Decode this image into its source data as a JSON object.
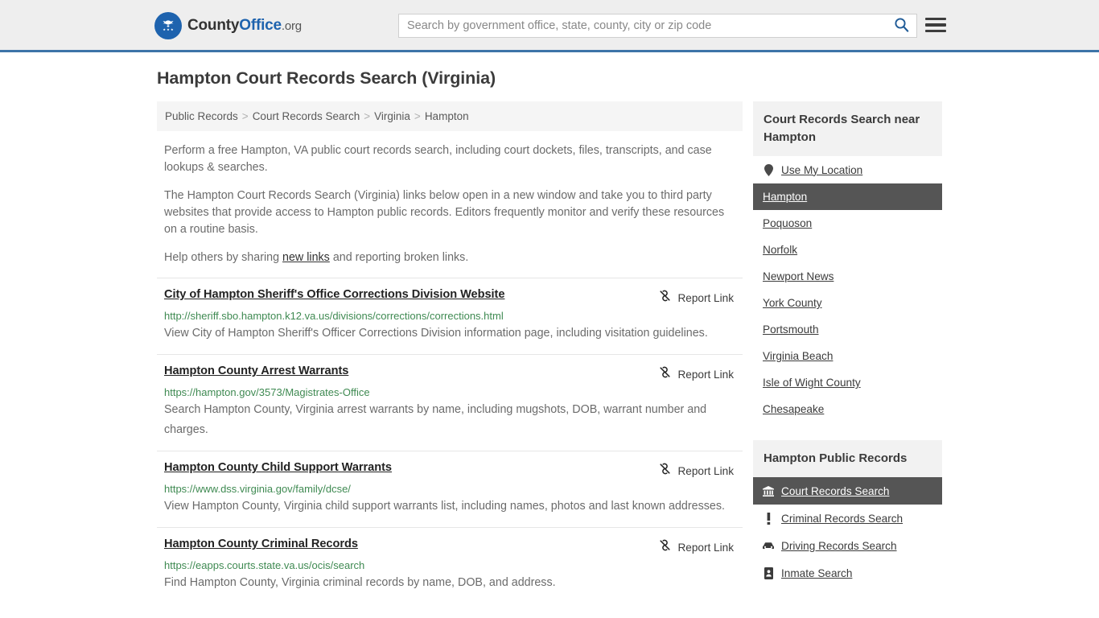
{
  "header": {
    "logo": {
      "part1": "County",
      "part2": "Office",
      "part3": ".org",
      "icon": "eagle-seal-icon"
    },
    "search": {
      "placeholder": "Search by government office, state, county, city or zip code",
      "value": "",
      "search_icon": "search-icon"
    },
    "menu_icon": "hamburger-menu-icon",
    "accent_color": "#1e63ae",
    "border_color": "#3d74a8",
    "background": "#eeeeee"
  },
  "page": {
    "title": "Hampton Court Records Search (Virginia)"
  },
  "breadcrumb": {
    "separator": ">",
    "items": [
      {
        "label": "Public Records"
      },
      {
        "label": "Court Records Search"
      },
      {
        "label": "Virginia"
      },
      {
        "label": "Hampton"
      }
    ]
  },
  "intro": {
    "p1": "Perform a free Hampton, VA public court records search, including court dockets, files, transcripts, and case lookups & searches.",
    "p2": "The Hampton Court Records Search (Virginia) links below open in a new window and take you to third party websites that provide access to Hampton public records. Editors frequently monitor and verify these resources on a routine basis.",
    "p3_before": "Help others by sharing ",
    "p3_link": "new links",
    "p3_after": " and reporting broken links."
  },
  "results": {
    "report_label": "Report Link",
    "report_icon": "broken-link-icon",
    "items": [
      {
        "title": "City of Hampton Sheriff's Office Corrections Division Website",
        "url": "http://sheriff.sbo.hampton.k12.va.us/divisions/corrections/corrections.html",
        "description": "View City of Hampton Sheriff's Officer Corrections Division information page, including visitation guidelines."
      },
      {
        "title": "Hampton County Arrest Warrants",
        "url": "https://hampton.gov/3573/Magistrates-Office",
        "description": "Search Hampton County, Virginia arrest warrants by name, including mugshots, DOB, warrant number and charges."
      },
      {
        "title": "Hampton County Child Support Warrants",
        "url": "https://www.dss.virginia.gov/family/dcse/",
        "description": "View Hampton County, Virginia child support warrants list, including names, photos and last known addresses."
      },
      {
        "title": "Hampton County Criminal Records",
        "url": "https://eapps.courts.state.va.us/ocis/search",
        "description": "Find Hampton County, Virginia criminal records by name, DOB, and address."
      }
    ]
  },
  "sidebar": {
    "nearby": {
      "heading": "Court Records Search near Hampton",
      "items": [
        {
          "label": "Use My Location",
          "icon": "map-pin-icon",
          "active": false
        },
        {
          "label": "Hampton",
          "icon": "",
          "active": true
        },
        {
          "label": "Poquoson",
          "icon": "",
          "active": false
        },
        {
          "label": "Norfolk",
          "icon": "",
          "active": false
        },
        {
          "label": "Newport News",
          "icon": "",
          "active": false
        },
        {
          "label": "York County",
          "icon": "",
          "active": false
        },
        {
          "label": "Portsmouth",
          "icon": "",
          "active": false
        },
        {
          "label": "Virginia Beach",
          "icon": "",
          "active": false
        },
        {
          "label": "Isle of Wight County",
          "icon": "",
          "active": false
        },
        {
          "label": "Chesapeake",
          "icon": "",
          "active": false
        }
      ]
    },
    "public_records": {
      "heading": "Hampton Public Records",
      "items": [
        {
          "label": "Court Records Search",
          "icon": "courthouse-icon",
          "active": true
        },
        {
          "label": "Criminal Records Search",
          "icon": "exclamation-icon",
          "active": false
        },
        {
          "label": "Driving Records Search",
          "icon": "car-icon",
          "active": false
        },
        {
          "label": "Inmate Search",
          "icon": "id-badge-icon",
          "active": false
        }
      ]
    },
    "active_background": "#555555",
    "heading_background": "#f2f2f2"
  }
}
